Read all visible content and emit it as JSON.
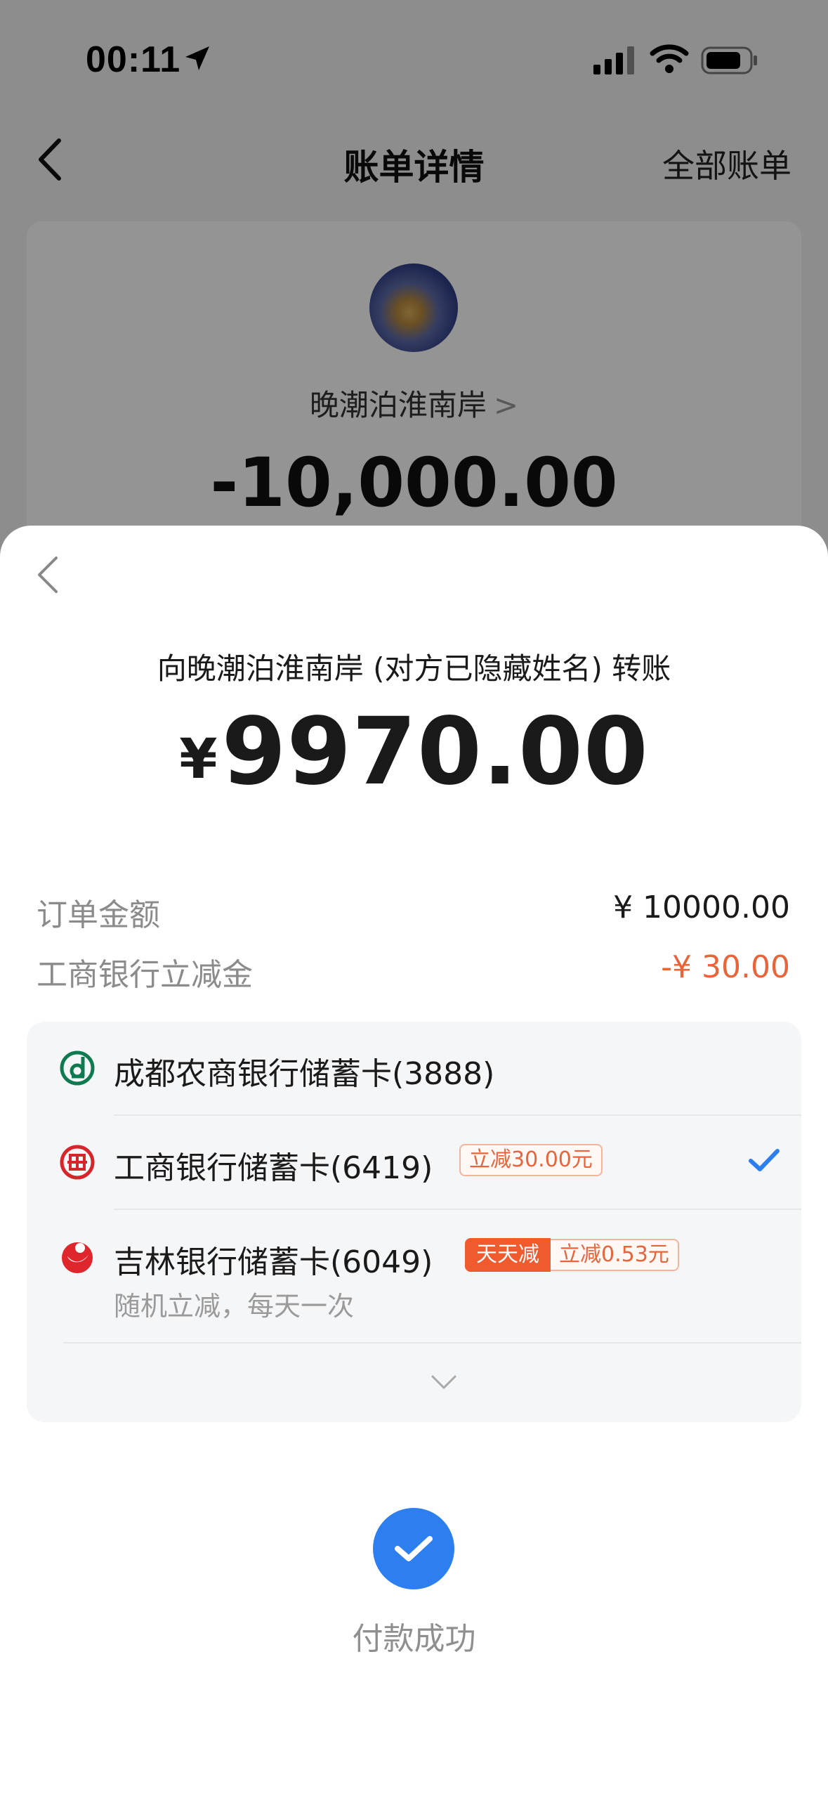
{
  "status_bar": {
    "time": "00:11"
  },
  "nav": {
    "title": "账单详情",
    "right_link": "全部账单"
  },
  "bill_card": {
    "payee": "晚潮泊淮南岸",
    "payee_chevron": ">",
    "amount": "-10,000.00"
  },
  "sheet": {
    "transfer_title": "向晚潮泊淮南岸 (对方已隐藏姓名) 转账",
    "currency_symbol": "¥",
    "pay_amount": "9970.00",
    "order_amount_label": "订单金额",
    "order_amount_value": "¥ 10000.00",
    "discount_label": "工商银行立减金",
    "discount_value": "-¥ 30.00",
    "cards": [
      {
        "name": "成都农商银行储蓄卡(3888)",
        "icon": "chengdu-rural-bank-logo"
      },
      {
        "name": "工商银行储蓄卡(6419)",
        "icon": "icbc-logo",
        "tag": "立减30.00元",
        "selected": true
      },
      {
        "name": "吉林银行储蓄卡(6049)",
        "icon": "bank-of-jilin-logo",
        "tag_highlight": "天天减",
        "tag": "立减0.53元",
        "note": "随机立减，每天一次"
      }
    ],
    "success_text": "付款成功"
  },
  "colors": {
    "accent_blue": "#2d7ff0",
    "discount_orange": "#e8643a",
    "icbc_red": "#d7262b",
    "chengdu_green": "#0f7a4f"
  }
}
